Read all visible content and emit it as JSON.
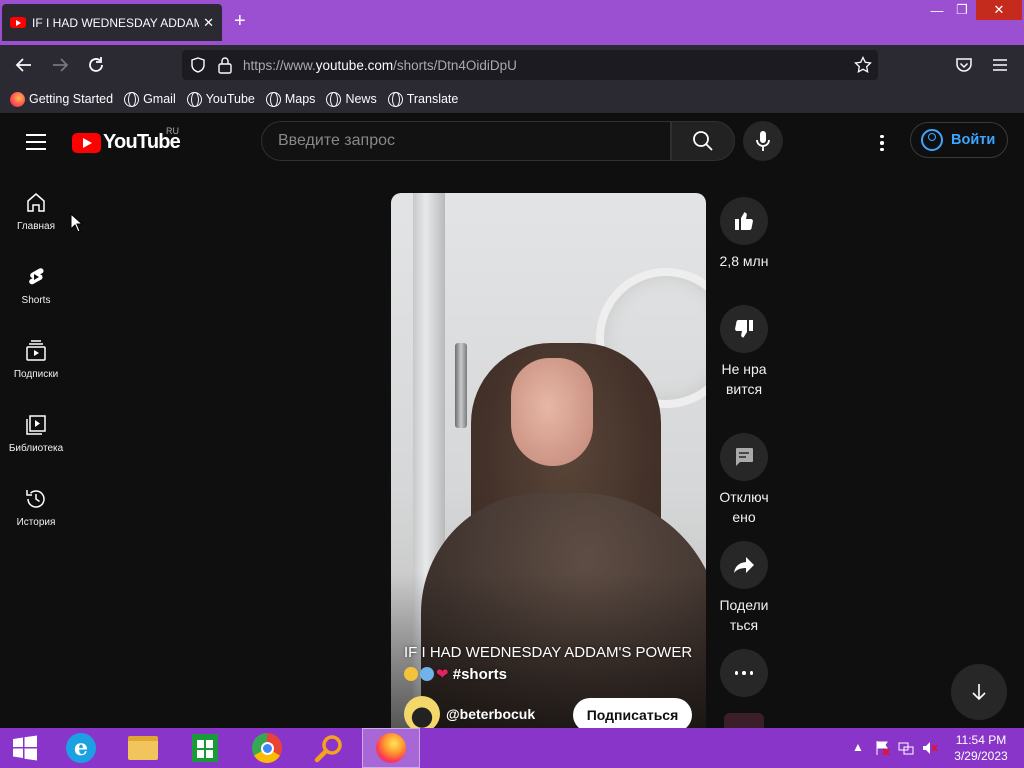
{
  "browser": {
    "tab_title": "IF I HAD WEDNESDAY ADDAMS",
    "url_prefix": "https://www.",
    "url_domain": "youtube.com",
    "url_path": "/shorts/Dtn4OidiDpU",
    "bookmarks": [
      "Getting Started",
      "Gmail",
      "YouTube",
      "Maps",
      "News",
      "Translate"
    ]
  },
  "youtube": {
    "logo_text": "YouTube",
    "region": "RU",
    "search_placeholder": "Введите запрос",
    "signin_label": "Войти",
    "sidebar": [
      "Главная",
      "Shorts",
      "Подписки",
      "Библиотека",
      "История"
    ],
    "video": {
      "title": "IF I HAD WEDNESDAY ADDAM'S POWER",
      "hashtag": "#shorts",
      "channel": "@beterbocuk",
      "subscribe_label": "Подписаться"
    },
    "actions": {
      "likes": "2,8 млн",
      "dislike": "Не нравится",
      "comments": "Отключено",
      "share": "Поделиться"
    }
  },
  "taskbar": {
    "time": "11:54 PM",
    "date": "3/29/2023"
  },
  "colors": {
    "firefox_titlebar": "#9b4fd1",
    "taskbar": "#8a35c9",
    "yt_bg": "#0f0f0f",
    "yt_red": "#ff0000",
    "link_blue": "#3ea6ff"
  }
}
